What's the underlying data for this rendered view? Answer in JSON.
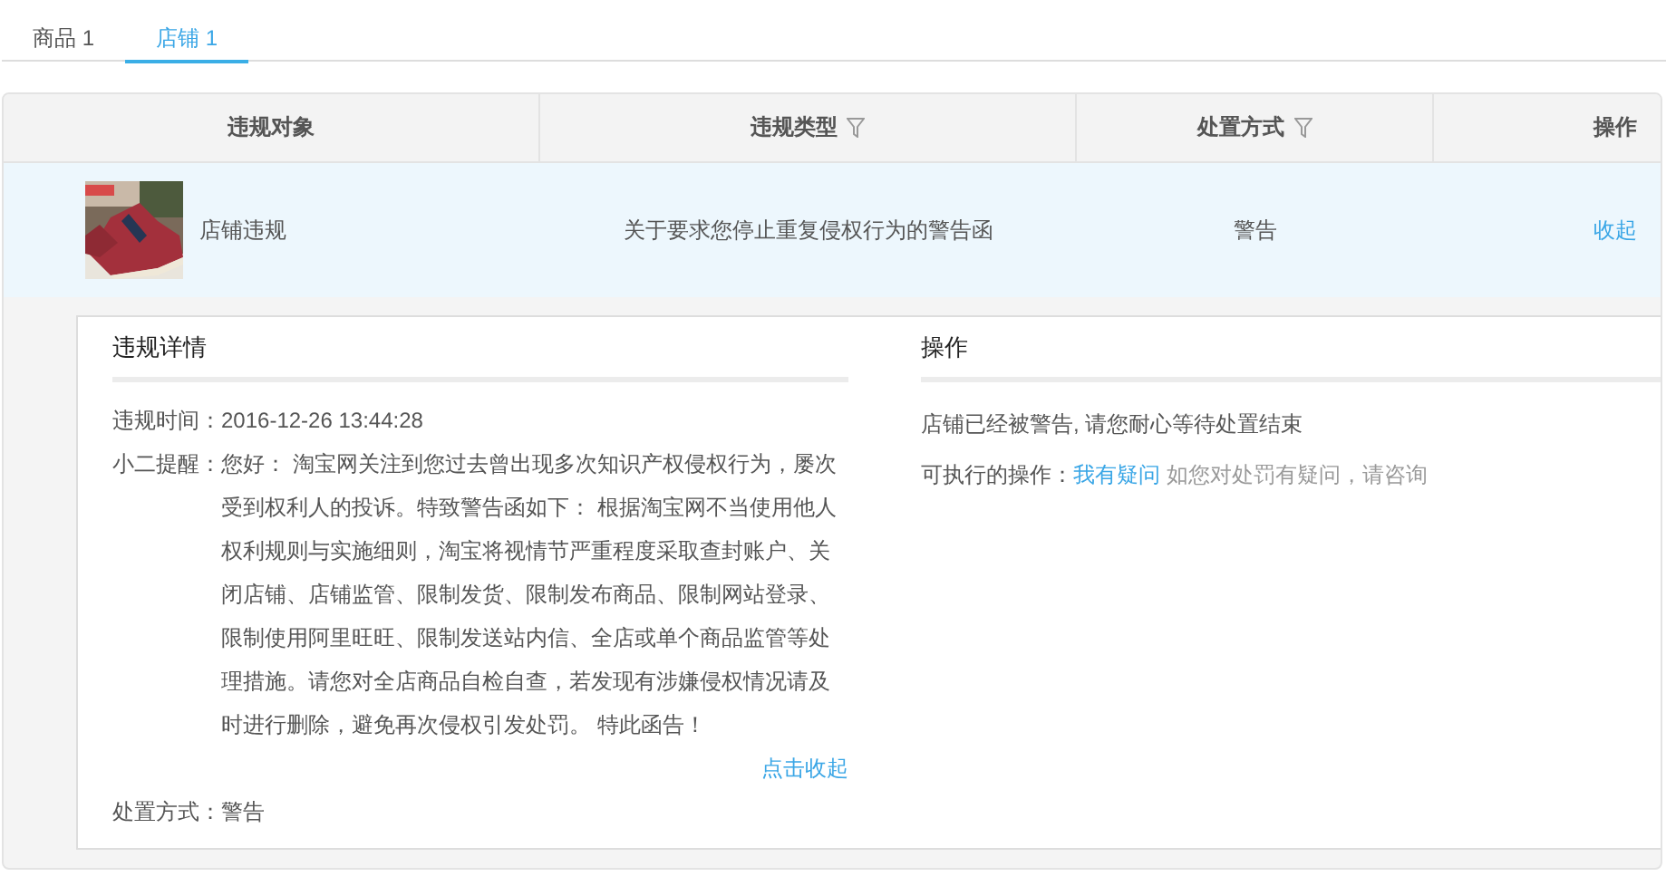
{
  "tabs": [
    {
      "label": "商品 1",
      "selected": false
    },
    {
      "label": "店铺 1",
      "selected": true
    }
  ],
  "table": {
    "columns": [
      {
        "label": "违规对象",
        "filter": false
      },
      {
        "label": "违规类型",
        "filter": true
      },
      {
        "label": "处置方式",
        "filter": true
      },
      {
        "label": "操作",
        "filter": false
      }
    ],
    "rows": [
      {
        "object": "店铺违规",
        "type": "关于要求您停止重复侵权行为的警告函",
        "method": "警告",
        "operation": "收起",
        "expanded": true
      }
    ]
  },
  "details": {
    "heading": "违规详情",
    "time_label": "违规时间：",
    "time": "2016-12-26 13:44:28",
    "reminder_label": "小二提醒：",
    "reminder": "您好： 淘宝网关注到您过去曾出现多次知识产权侵权行为，屡次受到权利人的投诉。特致警告函如下： 根据淘宝网不当使用他人权利规则与实施细则，淘宝将视情节严重程度采取查封账户、关闭店铺、店铺监管、限制发货、限制发布商品、限制网站登录、限制使用阿里旺旺、限制发送站内信、全店或单个商品监管等处理措施。请您对全店商品自检自查，若发现有涉嫌侵权情况请及时进行删除，避免再次侵权引发处罚。 特此函告！",
    "collapse_link": "点击收起",
    "method_label": "处置方式：",
    "method": "警告"
  },
  "operations": {
    "heading": "操作",
    "status": "店铺已经被警告, 请您耐心等待处置结束",
    "actions_label": "可执行的操作：",
    "link": "我有疑问",
    "hint": "如您对处罚有疑问，请咨询"
  }
}
